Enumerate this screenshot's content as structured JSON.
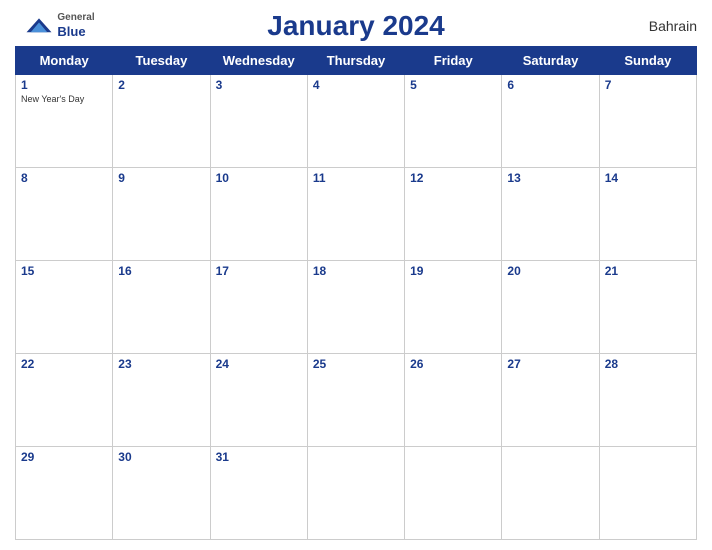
{
  "header": {
    "logo": {
      "general": "General",
      "blue": "Blue",
      "icon_alt": "GeneralBlue logo"
    },
    "title": "January 2024",
    "country": "Bahrain"
  },
  "weekdays": [
    "Monday",
    "Tuesday",
    "Wednesday",
    "Thursday",
    "Friday",
    "Saturday",
    "Sunday"
  ],
  "weeks": [
    [
      {
        "day": "1",
        "holiday": "New Year's Day"
      },
      {
        "day": "2",
        "holiday": ""
      },
      {
        "day": "3",
        "holiday": ""
      },
      {
        "day": "4",
        "holiday": ""
      },
      {
        "day": "5",
        "holiday": ""
      },
      {
        "day": "6",
        "holiday": ""
      },
      {
        "day": "7",
        "holiday": ""
      }
    ],
    [
      {
        "day": "8",
        "holiday": ""
      },
      {
        "day": "9",
        "holiday": ""
      },
      {
        "day": "10",
        "holiday": ""
      },
      {
        "day": "11",
        "holiday": ""
      },
      {
        "day": "12",
        "holiday": ""
      },
      {
        "day": "13",
        "holiday": ""
      },
      {
        "day": "14",
        "holiday": ""
      }
    ],
    [
      {
        "day": "15",
        "holiday": ""
      },
      {
        "day": "16",
        "holiday": ""
      },
      {
        "day": "17",
        "holiday": ""
      },
      {
        "day": "18",
        "holiday": ""
      },
      {
        "day": "19",
        "holiday": ""
      },
      {
        "day": "20",
        "holiday": ""
      },
      {
        "day": "21",
        "holiday": ""
      }
    ],
    [
      {
        "day": "22",
        "holiday": ""
      },
      {
        "day": "23",
        "holiday": ""
      },
      {
        "day": "24",
        "holiday": ""
      },
      {
        "day": "25",
        "holiday": ""
      },
      {
        "day": "26",
        "holiday": ""
      },
      {
        "day": "27",
        "holiday": ""
      },
      {
        "day": "28",
        "holiday": ""
      }
    ],
    [
      {
        "day": "29",
        "holiday": ""
      },
      {
        "day": "30",
        "holiday": ""
      },
      {
        "day": "31",
        "holiday": ""
      },
      {
        "day": "",
        "holiday": ""
      },
      {
        "day": "",
        "holiday": ""
      },
      {
        "day": "",
        "holiday": ""
      },
      {
        "day": "",
        "holiday": ""
      }
    ]
  ]
}
